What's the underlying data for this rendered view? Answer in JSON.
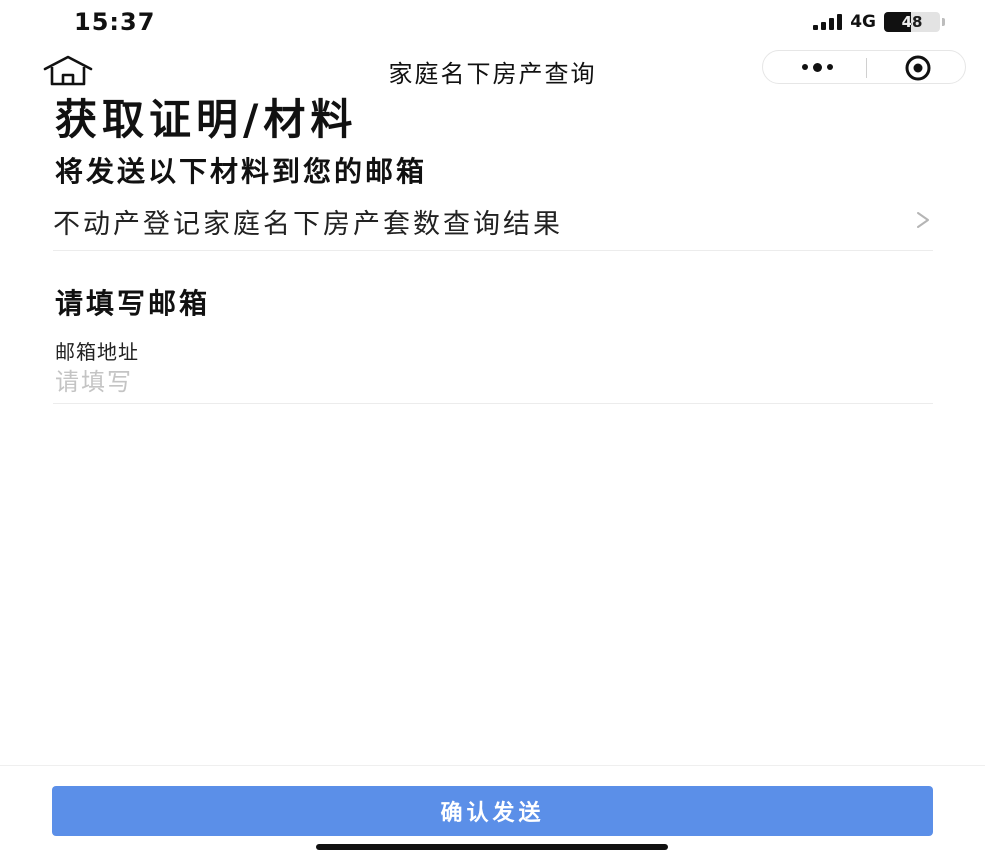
{
  "status_bar": {
    "time": "15:37",
    "network": "4G",
    "battery": "48",
    "battery_level": 0.48
  },
  "nav": {
    "title": "家庭名下房产查询"
  },
  "content": {
    "heading": "获取证明/材料",
    "materials_section_title": "将发送以下材料到您的邮箱",
    "material_item": "不动产登记家庭名下房产套数查询结果",
    "email_section_title": "请填写邮箱",
    "email_label": "邮箱地址",
    "email_placeholder": "请填写",
    "email_value": ""
  },
  "footer": {
    "confirm_label": "确认发送"
  },
  "colors": {
    "primary": "#5b8fe8",
    "placeholder": "#c4c4c4",
    "divider": "#ececec"
  },
  "icons": [
    "home-icon",
    "more-icon",
    "close-miniprogram-icon",
    "chevron-right-icon",
    "signal-icon",
    "battery-icon"
  ]
}
